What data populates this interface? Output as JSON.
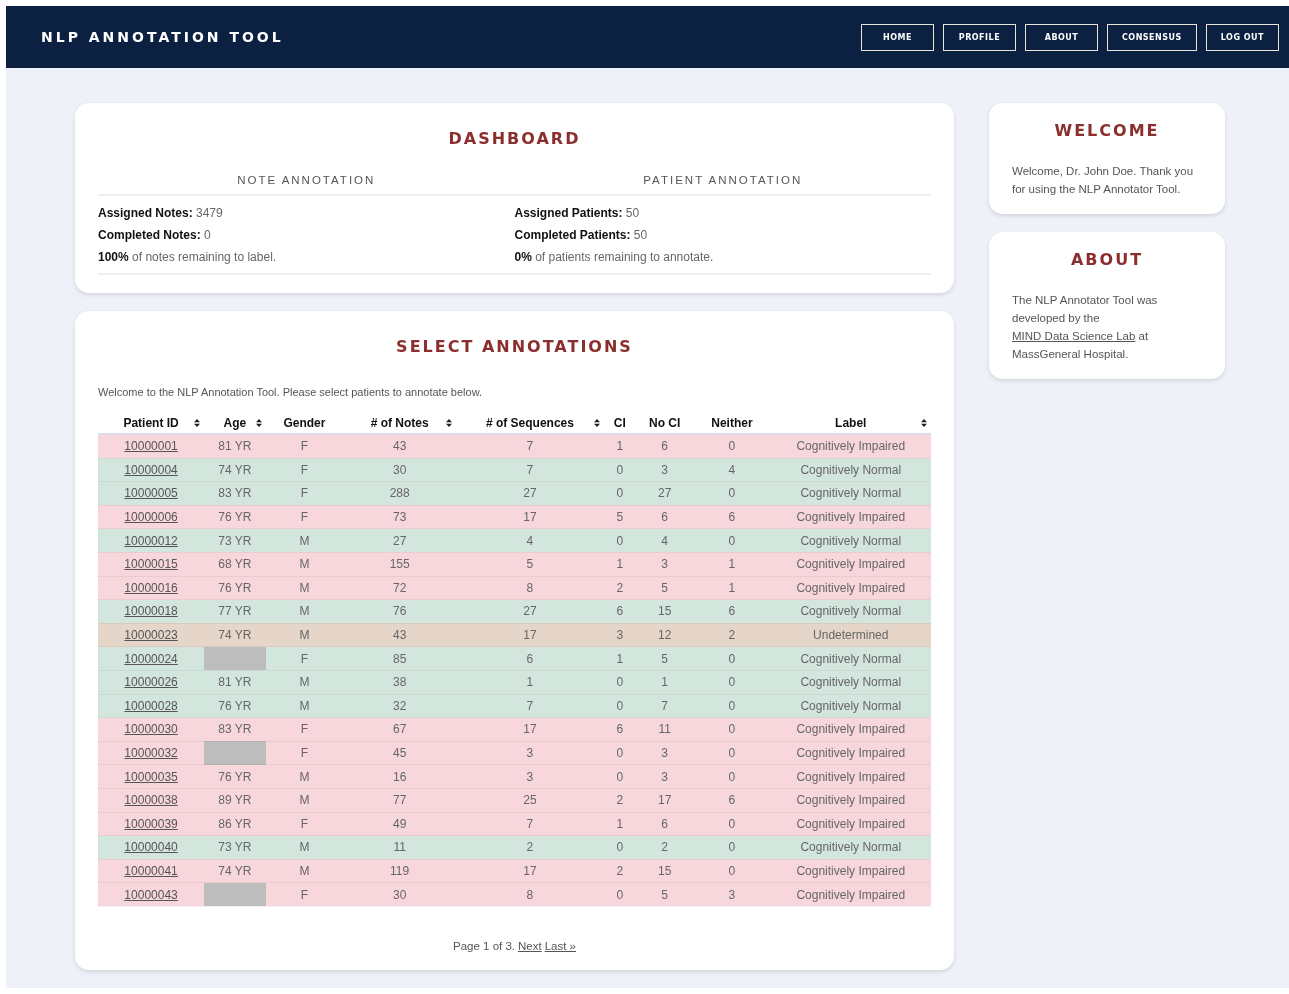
{
  "header": {
    "title": "NLP ANNOTATION TOOL",
    "nav": [
      {
        "label": "HOME"
      },
      {
        "label": "PROFILE"
      },
      {
        "label": "ABOUT"
      },
      {
        "label": "CONSENSUS"
      },
      {
        "label": "LOG OUT"
      }
    ]
  },
  "dashboard": {
    "title": "DASHBOARD",
    "sections": [
      {
        "heading": "NOTE ANNOTATION",
        "lines": [
          "**Assigned Notes:** 3479",
          "**Completed Notes:** 0",
          "**100%** of notes remaining to label."
        ]
      },
      {
        "heading": "PATIENT ANNOTATION",
        "lines": [
          "**Assigned Patients:** 50",
          "**Completed Patients:** 50",
          "**0%** of patients remaining to annotate."
        ]
      }
    ]
  },
  "select": {
    "title": "SELECT ANNOTATIONS",
    "intro": "Welcome to the NLP Annotation Tool. Please select patients to annotate below.",
    "table": {
      "columns": [
        {
          "label": "Patient ID",
          "sortable": true
        },
        {
          "label": "Age",
          "sortable": true
        },
        {
          "label": "Gender",
          "sortable": false
        },
        {
          "label": "# of Notes",
          "sortable": true
        },
        {
          "label": "# of Sequences",
          "sortable": true
        },
        {
          "label": "CI",
          "sortable": false
        },
        {
          "label": "No CI",
          "sortable": false
        },
        {
          "label": "Neither",
          "sortable": false
        },
        {
          "label": "Label",
          "sortable": true
        }
      ],
      "rows": [
        {
          "id": "10000001",
          "age": "81 YR",
          "redacted": false,
          "gender": "F",
          "notes": "43",
          "sequences": "7",
          "ci": "1",
          "no_ci": "6",
          "neither": "0",
          "label": "Cognitively Impaired",
          "color": "#f7d7db"
        },
        {
          "id": "10000004",
          "age": "74 YR",
          "redacted": false,
          "gender": "F",
          "notes": "30",
          "sequences": "7",
          "ci": "0",
          "no_ci": "3",
          "neither": "4",
          "label": "Cognitively Normal",
          "color": "#d3e6dd"
        },
        {
          "id": "10000005",
          "age": "83 YR",
          "redacted": false,
          "gender": "F",
          "notes": "288",
          "sequences": "27",
          "ci": "0",
          "no_ci": "27",
          "neither": "0",
          "label": "Cognitively Normal",
          "color": "#d3e6dd"
        },
        {
          "id": "10000006",
          "age": "76 YR",
          "redacted": false,
          "gender": "F",
          "notes": "73",
          "sequences": "17",
          "ci": "5",
          "no_ci": "6",
          "neither": "6",
          "label": "Cognitively Impaired",
          "color": "#f7d7db"
        },
        {
          "id": "10000012",
          "age": "73 YR",
          "redacted": false,
          "gender": "M",
          "notes": "27",
          "sequences": "4",
          "ci": "0",
          "no_ci": "4",
          "neither": "0",
          "label": "Cognitively Normal",
          "color": "#d3e6dd"
        },
        {
          "id": "10000015",
          "age": "68 YR",
          "redacted": false,
          "gender": "M",
          "notes": "155",
          "sequences": "5",
          "ci": "1",
          "no_ci": "3",
          "neither": "1",
          "label": "Cognitively Impaired",
          "color": "#f7d7db"
        },
        {
          "id": "10000016",
          "age": "76 YR",
          "redacted": false,
          "gender": "M",
          "notes": "72",
          "sequences": "8",
          "ci": "2",
          "no_ci": "5",
          "neither": "1",
          "label": "Cognitively Impaired",
          "color": "#f7d7db"
        },
        {
          "id": "10000018",
          "age": "77 YR",
          "redacted": false,
          "gender": "M",
          "notes": "76",
          "sequences": "27",
          "ci": "6",
          "no_ci": "15",
          "neither": "6",
          "label": "Cognitively Normal",
          "color": "#d3e6dd"
        },
        {
          "id": "10000023",
          "age": "74 YR",
          "redacted": false,
          "gender": "M",
          "notes": "43",
          "sequences": "17",
          "ci": "3",
          "no_ci": "12",
          "neither": "2",
          "label": "Undetermined",
          "color": "#e6d6c9"
        },
        {
          "id": "10000024",
          "redacted": true,
          "gender": "F",
          "notes": "85",
          "sequences": "6",
          "ci": "1",
          "no_ci": "5",
          "neither": "0",
          "label": "Cognitively Normal",
          "color": "#d3e6dd"
        },
        {
          "id": "10000026",
          "age": "81 YR",
          "redacted": false,
          "gender": "M",
          "notes": "38",
          "sequences": "1",
          "ci": "0",
          "no_ci": "1",
          "neither": "0",
          "label": "Cognitively Normal",
          "color": "#d3e6dd"
        },
        {
          "id": "10000028",
          "age": "76 YR",
          "redacted": false,
          "gender": "M",
          "notes": "32",
          "sequences": "7",
          "ci": "0",
          "no_ci": "7",
          "neither": "0",
          "label": "Cognitively Normal",
          "color": "#d3e6dd"
        },
        {
          "id": "10000030",
          "age": "83 YR",
          "redacted": false,
          "gender": "F",
          "notes": "67",
          "sequences": "17",
          "ci": "6",
          "no_ci": "11",
          "neither": "0",
          "label": "Cognitively Impaired",
          "color": "#f7d7db"
        },
        {
          "id": "10000032",
          "redacted": true,
          "gender": "F",
          "notes": "45",
          "sequences": "3",
          "ci": "0",
          "no_ci": "3",
          "neither": "0",
          "label": "Cognitively Impaired",
          "color": "#f7d7db"
        },
        {
          "id": "10000035",
          "age": "76 YR",
          "redacted": false,
          "gender": "M",
          "notes": "16",
          "sequences": "3",
          "ci": "0",
          "no_ci": "3",
          "neither": "0",
          "label": "Cognitively Impaired",
          "color": "#f7d7db"
        },
        {
          "id": "10000038",
          "age": "89 YR",
          "redacted": false,
          "gender": "M",
          "notes": "77",
          "sequences": "25",
          "ci": "2",
          "no_ci": "17",
          "neither": "6",
          "label": "Cognitively Impaired",
          "color": "#f7d7db"
        },
        {
          "id": "10000039",
          "age": "86 YR",
          "redacted": false,
          "gender": "F",
          "notes": "49",
          "sequences": "7",
          "ci": "1",
          "no_ci": "6",
          "neither": "0",
          "label": "Cognitively Impaired",
          "color": "#f7d7db"
        },
        {
          "id": "10000040",
          "age": "73 YR",
          "redacted": false,
          "gender": "M",
          "notes": "11",
          "sequences": "2",
          "ci": "0",
          "no_ci": "2",
          "neither": "0",
          "label": "Cognitively Normal",
          "color": "#d3e6dd"
        },
        {
          "id": "10000041",
          "age": "74 YR",
          "redacted": false,
          "gender": "M",
          "notes": "119",
          "sequences": "17",
          "ci": "2",
          "no_ci": "15",
          "neither": "0",
          "label": "Cognitively Impaired",
          "color": "#f7d7db"
        },
        {
          "id": "10000043",
          "redacted": true,
          "gender": "F",
          "notes": "30",
          "sequences": "8",
          "ci": "0",
          "no_ci": "5",
          "neither": "3",
          "label": "Cognitively Impaired",
          "color": "#f7d7db"
        }
      ]
    },
    "pagination": {
      "text": "Page 1 of 3.",
      "links": [
        "Next",
        "Last »"
      ]
    }
  },
  "sidebar": [
    {
      "title": "WELCOME",
      "text": "Welcome, Dr. John Doe. Thank you for using the NLP Annotator Tool."
    },
    {
      "title": "ABOUT",
      "text": "The NLP Annotator Tool was developed by the",
      "link": "MIND Data Science Lab",
      "text_after": "at MassGeneral Hospital."
    }
  ]
}
